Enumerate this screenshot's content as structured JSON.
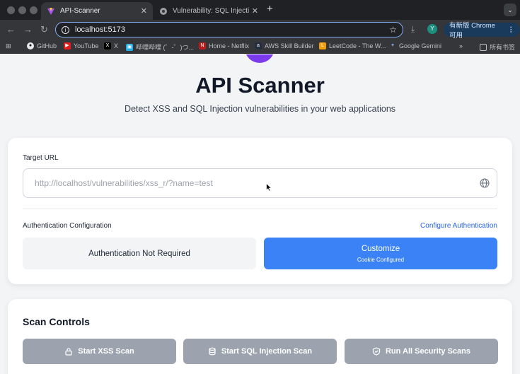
{
  "browser": {
    "tabs": [
      {
        "title": "API-Scanner",
        "active": true
      },
      {
        "title": "Vulnerability: SQL Injection ::",
        "active": false
      }
    ],
    "address": "localhost:5173",
    "update_label": "有新版 Chrome 可用",
    "bookmarks": [
      {
        "label": "GitHub",
        "icon": "github-icon"
      },
      {
        "label": "YouTube",
        "icon": "youtube-icon"
      },
      {
        "label": "X",
        "icon": "x-icon"
      },
      {
        "label": "哔哩哔哩 (゜-゜)つ...",
        "icon": "bilibili-icon"
      },
      {
        "label": "Home - Netflix",
        "icon": "netflix-icon"
      },
      {
        "label": "AWS Skill Builder",
        "icon": "aws-icon"
      },
      {
        "label": "LeetCode - The W...",
        "icon": "leetcode-icon"
      },
      {
        "label": "Google Gemini",
        "icon": "gemini-icon"
      }
    ],
    "bookmarks_overflow": "»",
    "all_bookmarks": "所有书签"
  },
  "hero": {
    "title": "API Scanner",
    "subtitle": "Detect XSS and SQL Injection vulnerabilities in your web applications"
  },
  "target": {
    "label": "Target URL",
    "placeholder": "http://localhost/vulnerabilities/xss_r/?name=test",
    "value": ""
  },
  "auth": {
    "label": "Authentication Configuration",
    "configure_link": "Configure Authentication",
    "not_required": "Authentication Not Required",
    "customize": "Customize",
    "customize_status": "Cookie Configured"
  },
  "scan": {
    "title": "Scan Controls",
    "buttons": [
      {
        "label": "Start XSS Scan",
        "icon": "lock-icon"
      },
      {
        "label": "Start SQL Injection Scan",
        "icon": "database-icon"
      },
      {
        "label": "Run All Security Scans",
        "icon": "shield-icon"
      }
    ]
  },
  "colors": {
    "accent": "#3b82f6",
    "link": "#2563eb",
    "disabled_button": "#9ca3af",
    "logo": "#7c3aed"
  }
}
